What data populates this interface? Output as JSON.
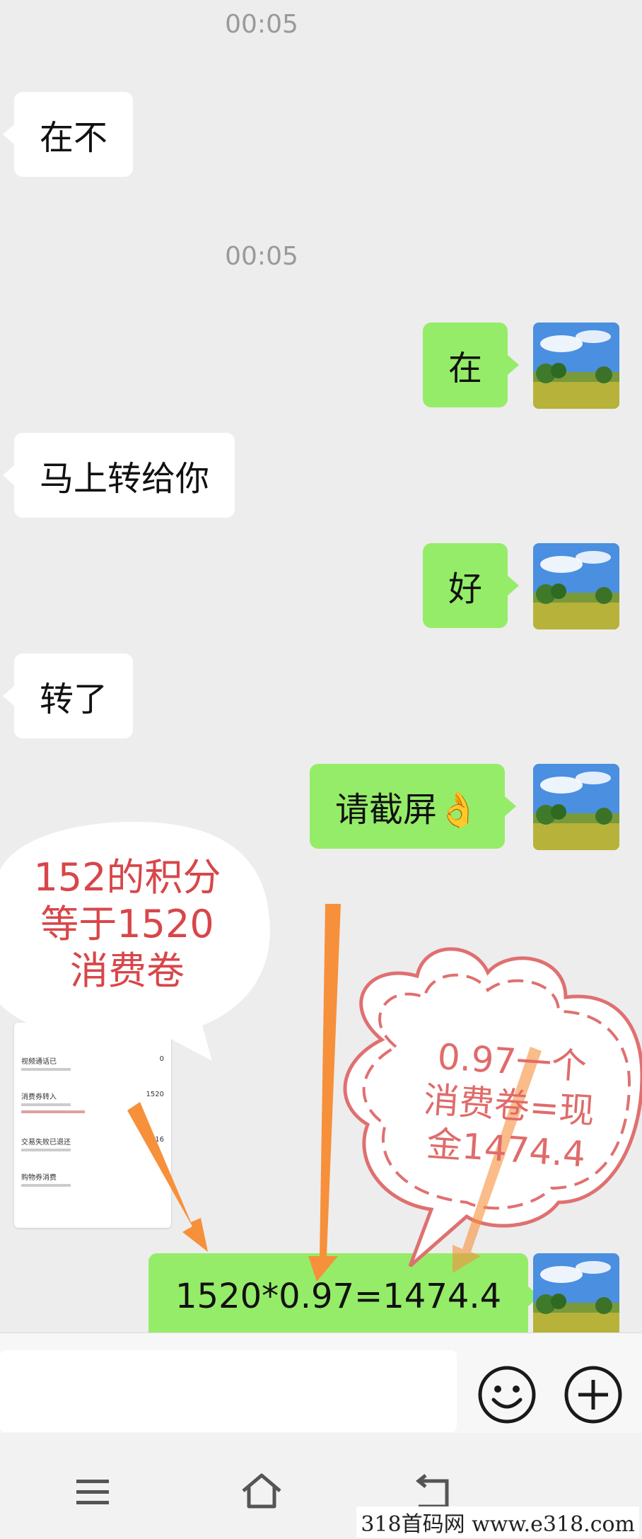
{
  "messages": [
    {
      "type": "time",
      "text": "00:05"
    },
    {
      "type": "in",
      "text": "在不"
    },
    {
      "type": "time",
      "text": "00:05"
    },
    {
      "type": "out",
      "text": "在"
    },
    {
      "type": "in",
      "text": "马上转给你"
    },
    {
      "type": "out",
      "text": "好"
    },
    {
      "type": "in",
      "text": "转了"
    },
    {
      "type": "out",
      "text": "请截屏👌"
    },
    {
      "type": "in-image",
      "text": ""
    },
    {
      "type": "out",
      "text": "1520*0.97=1474.4"
    }
  ],
  "thumbnail": {
    "rows": [
      {
        "label": "视频通话已",
        "value": "0"
      },
      {
        "label": "消费券转入",
        "value": "1520"
      },
      {
        "label": "交易失败已退还",
        "value": "16"
      },
      {
        "label": "购物券消费",
        "value": ""
      }
    ]
  },
  "annotations": {
    "left_bubble": [
      "152的积分",
      "等于1520",
      "消费卷"
    ],
    "right_cloud": [
      "0.97一个",
      "消费卷=现",
      "金1474.4"
    ]
  },
  "input": {
    "placeholder": "",
    "emoji_icon": "smile-icon",
    "plus_icon": "plus-icon"
  },
  "nav": {
    "menu_icon": "menu-icon",
    "home_icon": "home-icon",
    "back_icon": "back-icon"
  },
  "watermark": "318首码网 www.e318.com",
  "colors": {
    "outgoing": "#95ec69",
    "incoming": "#ffffff",
    "annotation_red": "#d8464a",
    "arrow": "#f7903a"
  }
}
